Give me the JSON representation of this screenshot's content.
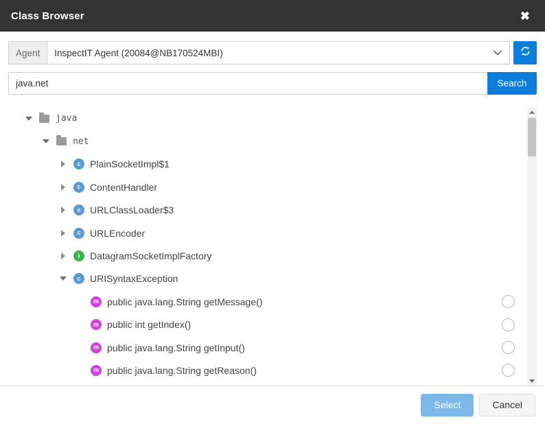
{
  "window": {
    "title": "Class Browser",
    "close_icon": "close-icon"
  },
  "agent": {
    "label": "Agent",
    "selected": "InspectIT Agent (20084@NB170524MBI)",
    "chevron_icon": "chevron-down-icon",
    "refresh_icon": "refresh-icon",
    "refresh_color": "#0d7ddb"
  },
  "search": {
    "value": "java.net",
    "placeholder": "",
    "button_label": "Search",
    "button_color": "#0d7ddb"
  },
  "tree": {
    "nodes": [
      {
        "label": "java",
        "kind": "package",
        "indent": 0,
        "state": "expanded",
        "icon": "folder-icon",
        "radio": false
      },
      {
        "label": "net",
        "kind": "package",
        "indent": 1,
        "state": "expanded",
        "icon": "folder-icon",
        "radio": false
      },
      {
        "label": "PlainSocketImpl$1",
        "kind": "class",
        "indent": 2,
        "state": "collapsed",
        "icon": "class-badge-icon",
        "radio": false
      },
      {
        "label": "ContentHandler",
        "kind": "class",
        "indent": 2,
        "state": "collapsed",
        "icon": "class-badge-icon",
        "radio": false
      },
      {
        "label": "URLClassLoader$3",
        "kind": "class",
        "indent": 2,
        "state": "collapsed",
        "icon": "class-badge-icon",
        "radio": false
      },
      {
        "label": "URLEncoder",
        "kind": "class",
        "indent": 2,
        "state": "collapsed",
        "icon": "class-badge-icon",
        "radio": false
      },
      {
        "label": "DatagramSocketImplFactory",
        "kind": "interface",
        "indent": 2,
        "state": "collapsed",
        "icon": "interface-badge-icon",
        "radio": false
      },
      {
        "label": "URISyntaxException",
        "kind": "class",
        "indent": 2,
        "state": "expanded",
        "icon": "class-badge-icon",
        "radio": false
      },
      {
        "label": "public java.lang.String getMessage()",
        "kind": "method",
        "indent": 3,
        "state": "leaf",
        "icon": "method-badge-icon",
        "radio": true
      },
      {
        "label": "public int getIndex()",
        "kind": "method",
        "indent": 3,
        "state": "leaf",
        "icon": "method-badge-icon",
        "radio": true
      },
      {
        "label": "public java.lang.String getInput()",
        "kind": "method",
        "indent": 3,
        "state": "leaf",
        "icon": "method-badge-icon",
        "radio": true
      },
      {
        "label": "public java.lang.String getReason()",
        "kind": "method",
        "indent": 3,
        "state": "leaf",
        "icon": "method-badge-icon",
        "radio": true
      }
    ],
    "badge_letters": {
      "class": "c",
      "interface": "i",
      "method": "m"
    },
    "badge_colors": {
      "class": "#5b9bd5",
      "interface": "#3cb44b",
      "method": "#cc44dd"
    },
    "scrollbar": {
      "up_icon": "scroll-up-arrow-icon",
      "down_icon": "scroll-down-arrow-icon"
    }
  },
  "footer": {
    "select_label": "Select",
    "cancel_label": "Cancel",
    "select_color": "#7cb9e8"
  }
}
